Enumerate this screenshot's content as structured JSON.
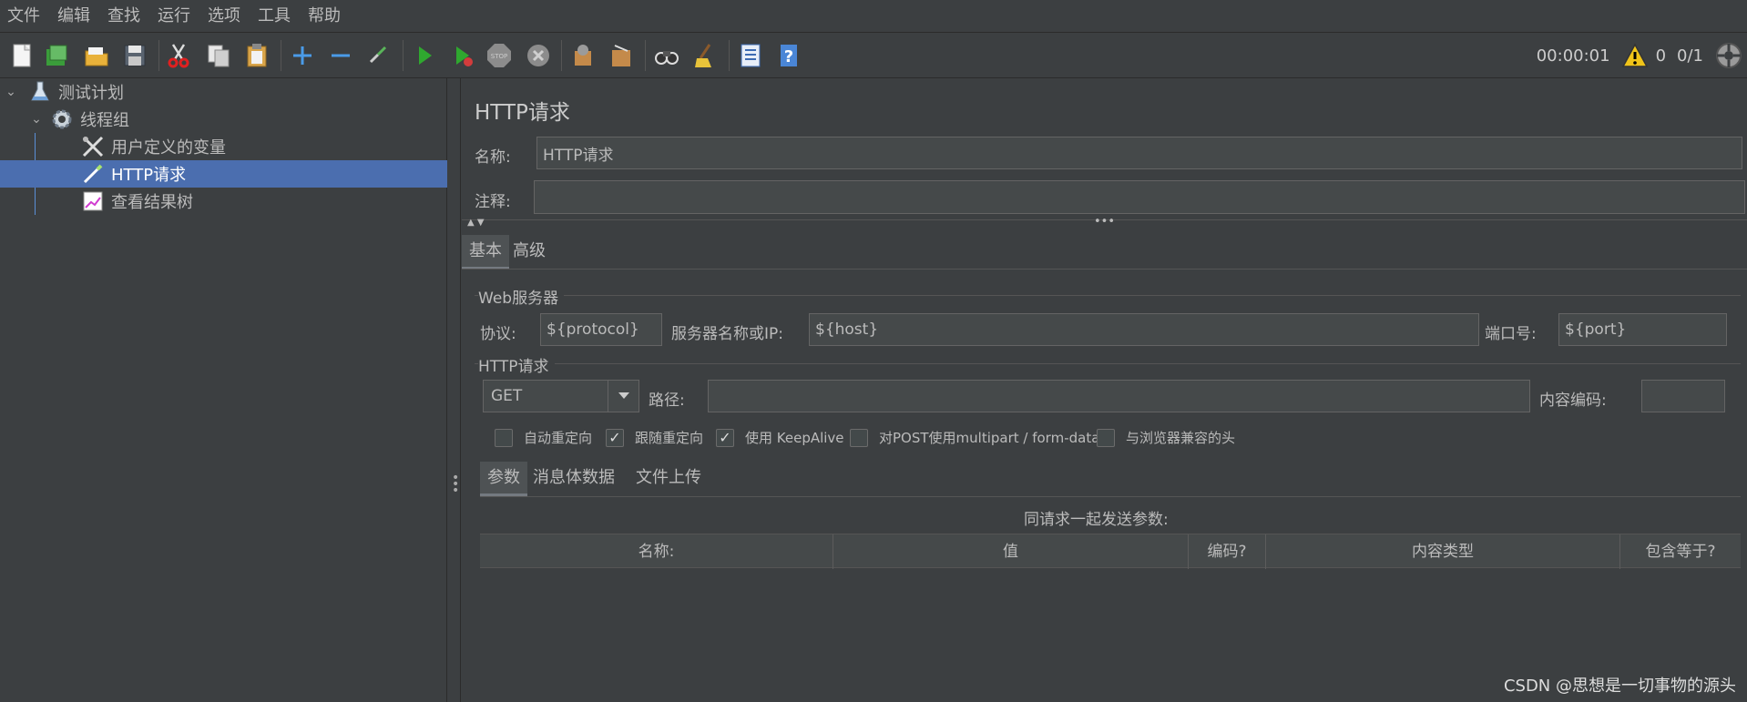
{
  "menu": [
    "文件",
    "编辑",
    "查找",
    "运行",
    "选项",
    "工具",
    "帮助"
  ],
  "toolbar": {
    "icons": [
      "new-icon",
      "templates-icon",
      "open-icon",
      "save-icon",
      "cut-icon",
      "copy-icon",
      "paste-icon",
      "expand-icon",
      "collapse-icon",
      "toggle-icon",
      "start-icon",
      "start-no-pause-icon",
      "stop-icon",
      "shutdown-icon",
      "clear-icon",
      "clear-all-icon",
      "search-icon",
      "reset-search-icon",
      "function-helper-icon",
      "help-icon"
    ]
  },
  "status": {
    "elapsed": "00:00:01",
    "warnings": "0",
    "threads": "0/1"
  },
  "tree": {
    "items": [
      {
        "label": "测试计划"
      },
      {
        "label": "线程组"
      },
      {
        "label": "用户定义的变量"
      },
      {
        "label": "HTTP请求"
      },
      {
        "label": "查看结果树"
      }
    ]
  },
  "panel": {
    "title": "HTTP请求",
    "name_label": "名称:",
    "name_value": "HTTP请求",
    "comment_label": "注释:",
    "comment_value": "",
    "tabs": [
      "基本",
      "高级"
    ],
    "web_server": {
      "title": "Web服务器",
      "protocol_label": "协议:",
      "protocol_value": "${protocol}",
      "server_label": "服务器名称或IP:",
      "server_value": "${host}",
      "port_label": "端口号:",
      "port_value": "${port}"
    },
    "http_request": {
      "title": "HTTP请求",
      "method": "GET",
      "path_label": "路径:",
      "path_value": "",
      "encoding_label": "内容编码:",
      "encoding_value": ""
    },
    "checkboxes": [
      {
        "label": "自动重定向",
        "checked": false
      },
      {
        "label": "跟随重定向",
        "checked": true
      },
      {
        "label": "使用 KeepAlive",
        "checked": true
      },
      {
        "label": "对POST使用multipart / form-data",
        "checked": false
      },
      {
        "label": "与浏览器兼容的头",
        "checked": false
      }
    ],
    "sub_tabs": [
      "参数",
      "消息体数据",
      "文件上传"
    ],
    "table_caption": "同请求一起发送参数:",
    "columns": [
      "名称:",
      "值",
      "编码?",
      "内容类型",
      "包含等于?"
    ]
  },
  "watermark": "CSDN @思想是一切事物的源头"
}
